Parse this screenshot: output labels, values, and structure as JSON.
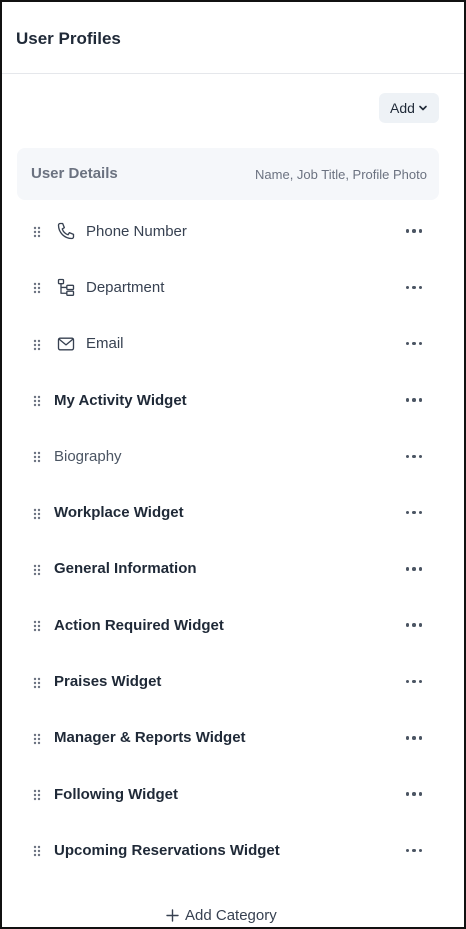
{
  "header": {
    "title": "User Profiles"
  },
  "toolbar": {
    "add_label": "Add"
  },
  "user_details": {
    "title": "User Details",
    "fields": "Name, Job Title, Profile Photo"
  },
  "rows": [
    {
      "label": "Phone Number",
      "icon": "phone-icon",
      "style": "with-icon"
    },
    {
      "label": "Department",
      "icon": "department-tree-icon",
      "style": "with-icon"
    },
    {
      "label": "Email",
      "icon": "mail-icon",
      "style": "with-icon"
    },
    {
      "label": "My Activity Widget",
      "style": "bold"
    },
    {
      "label": "Biography",
      "style": "plain"
    },
    {
      "label": "Workplace Widget",
      "style": "bold"
    },
    {
      "label": "General Information",
      "style": "bold"
    },
    {
      "label": "Action Required Widget",
      "style": "bold"
    },
    {
      "label": "Praises Widget",
      "style": "bold"
    },
    {
      "label": "Manager & Reports Widget",
      "style": "bold"
    },
    {
      "label": "Following Widget",
      "style": "bold"
    },
    {
      "label": "Upcoming Reservations Widget",
      "style": "bold"
    }
  ],
  "footer": {
    "add_category_label": "Add Category"
  }
}
